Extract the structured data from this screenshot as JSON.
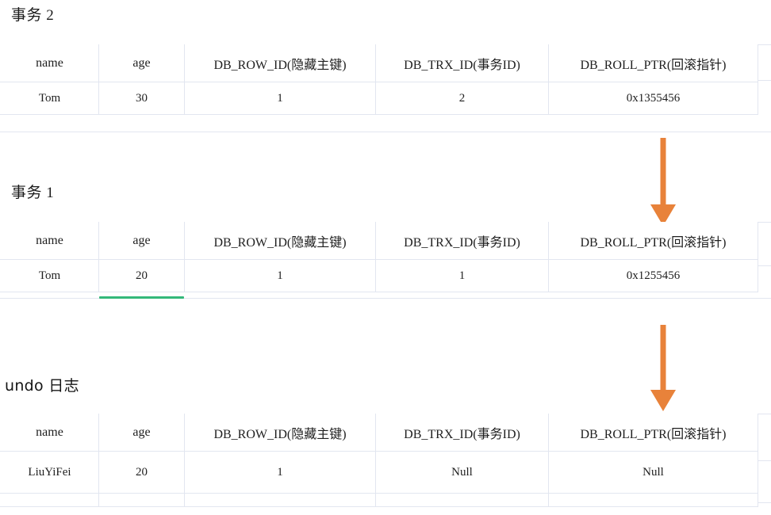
{
  "page": {
    "background_color": "#ffffff",
    "border_color": "#e2e6f0",
    "arrow_color": "#e8823a",
    "highlight_color": "#33b87a"
  },
  "columns": [
    "name",
    "age",
    "DB_ROW_ID(隐藏主键)",
    "DB_TRX_ID(事务ID)",
    "DB_ROLL_PTR(回滚指针)"
  ],
  "sections": [
    {
      "id": "trx2",
      "title": "事务 2",
      "title_style": "serif",
      "rows": [
        [
          "Tom",
          "30",
          "1",
          "2",
          "0x1355456"
        ]
      ]
    },
    {
      "id": "trx1",
      "title": "事务 1",
      "title_style": "serif",
      "rows": [
        [
          "Tom",
          "20",
          "1",
          "1",
          "0x1255456"
        ]
      ],
      "highlight": {
        "column": "age",
        "value": "20",
        "color": "#33b87a"
      }
    },
    {
      "id": "undo",
      "title": "undo 日志",
      "title_style": "sans",
      "rows": [
        [
          "LiuYiFei",
          "20",
          "1",
          "Null",
          "Null"
        ]
      ]
    }
  ],
  "arrows": [
    {
      "id": "arrow-trx2-to-trx1",
      "direction": "down",
      "color": "#e8823a",
      "from_section": "trx2",
      "to_section": "trx1"
    },
    {
      "id": "arrow-trx1-to-undo",
      "direction": "down",
      "color": "#e8823a",
      "from_section": "trx1",
      "to_section": "undo"
    }
  ]
}
